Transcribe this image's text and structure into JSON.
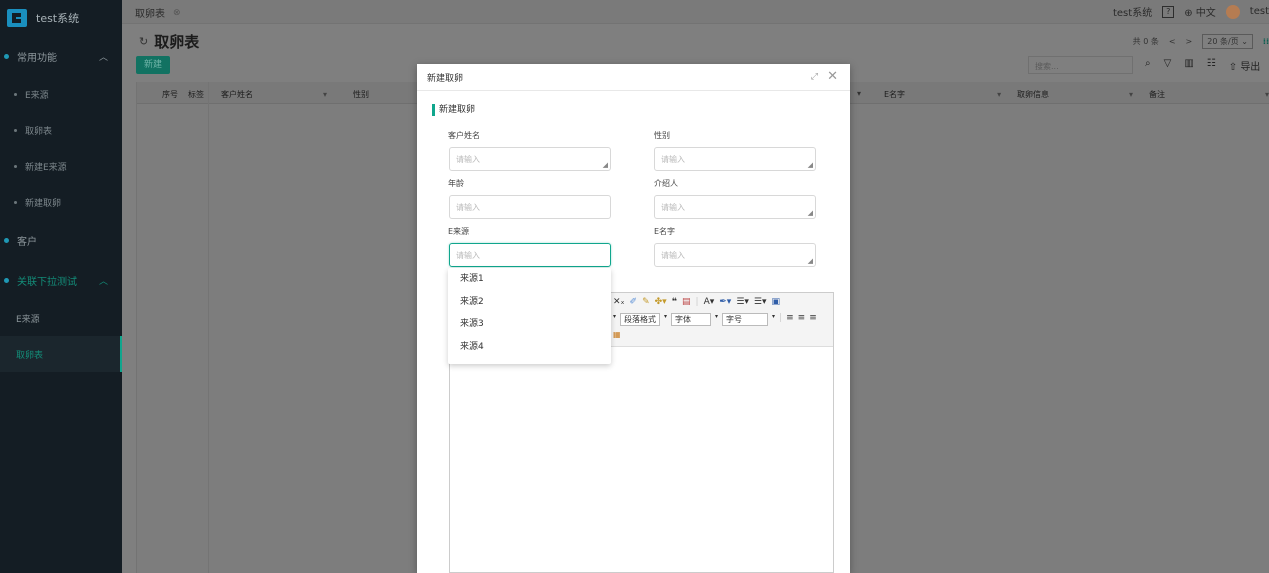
{
  "app": {
    "title": "test系统"
  },
  "sidebar": {
    "groups": [
      {
        "label": "常用功能",
        "items": [
          "E来源",
          "取卵表",
          "新建E来源",
          "新建取卵"
        ]
      },
      {
        "label": "客户"
      },
      {
        "label": "关联下拉测试",
        "items": [
          "E来源",
          "取卵表"
        ]
      }
    ]
  },
  "topbar": {
    "tab": "取卵表",
    "system": "test系统",
    "help": "?",
    "language": "中文",
    "user": "test"
  },
  "page": {
    "title": "取卵表",
    "new_button": "新建",
    "pager": {
      "total": "共 0 条",
      "prev": "<",
      "next": ">",
      "page_size": "20 条/页"
    },
    "search_placeholder": "搜索...",
    "export": "导出"
  },
  "table": {
    "columns": [
      "序号",
      "标签",
      "客户姓名",
      "性别",
      "E名字",
      "取卵信息",
      "备注"
    ]
  },
  "modal": {
    "title": "新建取卵",
    "section": "新建取卵",
    "fields": [
      {
        "label": "客户姓名",
        "placeholder": "请输入"
      },
      {
        "label": "性别",
        "placeholder": "请输入"
      },
      {
        "label": "年龄",
        "placeholder": "请输入"
      },
      {
        "label": "介绍人",
        "placeholder": "请输入"
      },
      {
        "label": "E来源",
        "placeholder": "请输入"
      },
      {
        "label": "E名字",
        "placeholder": "请输入"
      }
    ],
    "editor": {
      "paragraph_format": "段落格式",
      "font": "字体",
      "font_size": "字号"
    }
  },
  "dropdown": {
    "options": [
      "来源1",
      "来源2",
      "来源3",
      "来源4"
    ]
  },
  "colors": {
    "accent": "#10a68d",
    "sidebar_bg": "#141d24",
    "overlay": "#7f7f7f"
  }
}
